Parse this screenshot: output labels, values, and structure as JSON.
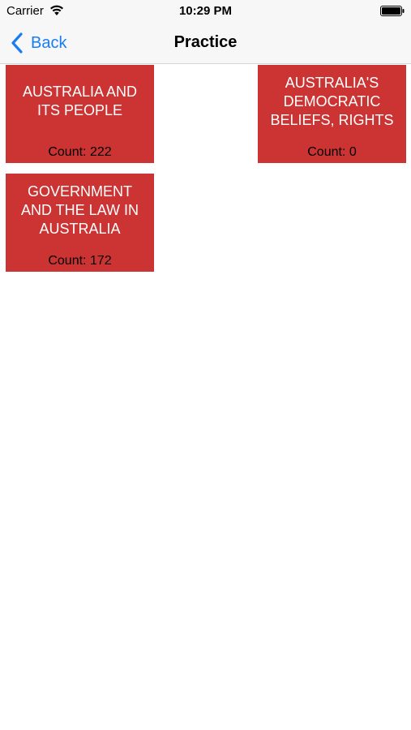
{
  "status": {
    "carrier": "Carrier",
    "time": "10:29 PM"
  },
  "nav": {
    "back_label": "Back",
    "title": "Practice"
  },
  "tiles": [
    {
      "title": "AUSTRALIA AND ITS PEOPLE",
      "count_prefix": "Count: ",
      "count": "222"
    },
    {
      "title": "AUSTRALIA'S DEMOCRATIC BELIEFS, RIGHTS",
      "count_prefix": "Count: ",
      "count": "0"
    },
    {
      "title": "GOVERNMENT AND THE LAW IN AUSTRALIA",
      "count_prefix": "Count: ",
      "count": "172"
    }
  ],
  "colors": {
    "tile_bg": "#cc3333",
    "accent": "#1a7cf5"
  }
}
